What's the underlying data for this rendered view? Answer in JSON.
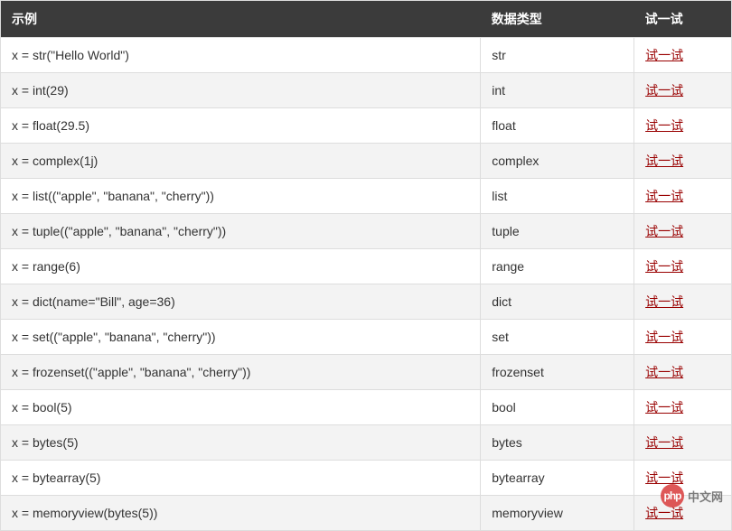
{
  "table": {
    "headers": {
      "example": "示例",
      "type": "数据类型",
      "try": "试一试"
    },
    "try_label": "试一试",
    "rows": [
      {
        "example": "x = str(\"Hello World\")",
        "type": "str"
      },
      {
        "example": "x = int(29)",
        "type": "int"
      },
      {
        "example": "x = float(29.5)",
        "type": "float"
      },
      {
        "example": "x = complex(1j)",
        "type": "complex"
      },
      {
        "example": "x = list((\"apple\", \"banana\", \"cherry\"))",
        "type": "list"
      },
      {
        "example": "x = tuple((\"apple\", \"banana\", \"cherry\"))",
        "type": "tuple"
      },
      {
        "example": "x = range(6)",
        "type": "range"
      },
      {
        "example": "x = dict(name=\"Bill\", age=36)",
        "type": "dict"
      },
      {
        "example": "x = set((\"apple\", \"banana\", \"cherry\"))",
        "type": "set"
      },
      {
        "example": "x = frozenset((\"apple\", \"banana\", \"cherry\"))",
        "type": "frozenset"
      },
      {
        "example": "x = bool(5)",
        "type": "bool"
      },
      {
        "example": "x = bytes(5)",
        "type": "bytes"
      },
      {
        "example": "x = bytearray(5)",
        "type": "bytearray"
      },
      {
        "example": "x = memoryview(bytes(5))",
        "type": "memoryview"
      }
    ]
  },
  "watermark": {
    "icon": "php",
    "text": "中文网"
  }
}
